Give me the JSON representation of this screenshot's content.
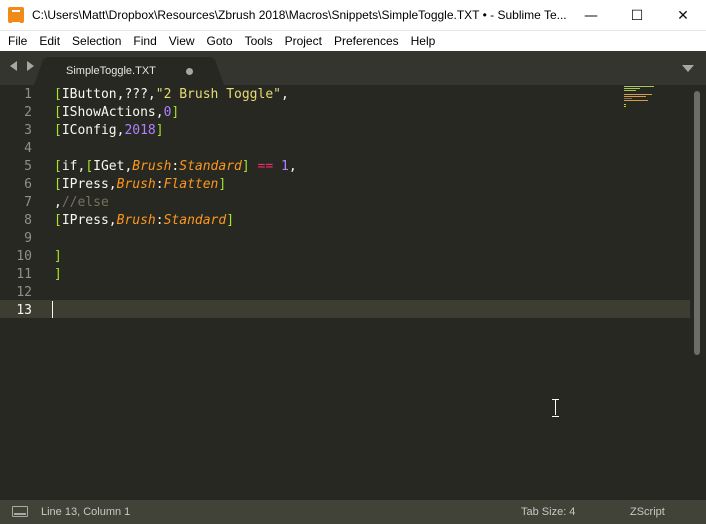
{
  "window": {
    "title": "C:\\Users\\Matt\\Dropbox\\Resources\\Zbrush 2018\\Macros\\Snippets\\SimpleToggle.TXT • - Sublime Te...",
    "minimize_glyph": "—",
    "maximize_glyph": "☐",
    "close_glyph": "✕"
  },
  "menu": [
    "File",
    "Edit",
    "Selection",
    "Find",
    "View",
    "Goto",
    "Tools",
    "Project",
    "Preferences",
    "Help"
  ],
  "tab": {
    "label": "SimpleToggle.TXT",
    "modified": true
  },
  "editor": {
    "line_numbers": [
      "1",
      "2",
      "3",
      "4",
      "5",
      "6",
      "7",
      "8",
      "9",
      "10",
      "11",
      "12",
      "13"
    ],
    "current_line": 13,
    "lines": [
      [
        [
          "br",
          "["
        ],
        [
          "w",
          "IButton,???,"
        ],
        [
          "s",
          "\"2 Brush Toggle\""
        ],
        [
          "w",
          ","
        ]
      ],
      [
        [
          "br",
          "["
        ],
        [
          "w",
          "IShowActions,"
        ],
        [
          "n",
          "0"
        ],
        [
          "br",
          "]"
        ]
      ],
      [
        [
          "br",
          "["
        ],
        [
          "w",
          "IConfig,"
        ],
        [
          "n",
          "2018"
        ],
        [
          "br",
          "]"
        ]
      ],
      [],
      [
        [
          "br",
          "["
        ],
        [
          "w",
          "if,"
        ],
        [
          "br",
          "["
        ],
        [
          "w",
          "IGet,"
        ],
        [
          "it",
          "Brush"
        ],
        [
          "w",
          ":"
        ],
        [
          "it",
          "Standard"
        ],
        [
          "br",
          "]"
        ],
        [
          "w",
          " "
        ],
        [
          "op",
          "=="
        ],
        [
          "w",
          " "
        ],
        [
          "n",
          "1"
        ],
        [
          "w",
          ","
        ]
      ],
      [
        [
          "br",
          "["
        ],
        [
          "w",
          "IPress,"
        ],
        [
          "it",
          "Brush"
        ],
        [
          "w",
          ":"
        ],
        [
          "it",
          "Flatten"
        ],
        [
          "br",
          "]"
        ]
      ],
      [
        [
          "w",
          ","
        ],
        [
          "c",
          "//else"
        ]
      ],
      [
        [
          "br",
          "["
        ],
        [
          "w",
          "IPress,"
        ],
        [
          "it",
          "Brush"
        ],
        [
          "w",
          ":"
        ],
        [
          "it",
          "Standard"
        ],
        [
          "br",
          "]"
        ]
      ],
      [],
      [
        [
          "br",
          "]"
        ]
      ],
      [
        [
          "br",
          "]"
        ]
      ],
      [],
      []
    ]
  },
  "status": {
    "position": "Line 13, Column 1",
    "tab_size": "Tab Size: 4",
    "syntax": "ZScript"
  },
  "colors": {
    "background": "#272822",
    "bracket": "#a6e22e",
    "string": "#e6db74",
    "number": "#ae81ff",
    "italic_keyword": "#fd971f",
    "operator": "#f92672",
    "comment": "#75715e",
    "status_bar": "#414339"
  },
  "icons": {
    "app": "sublime-text-icon",
    "nav_back": "chevron-left-icon",
    "nav_forward": "chevron-right-icon",
    "tab_dropdown": "chevron-down-icon",
    "status_panel": "panel-toggle-icon"
  }
}
